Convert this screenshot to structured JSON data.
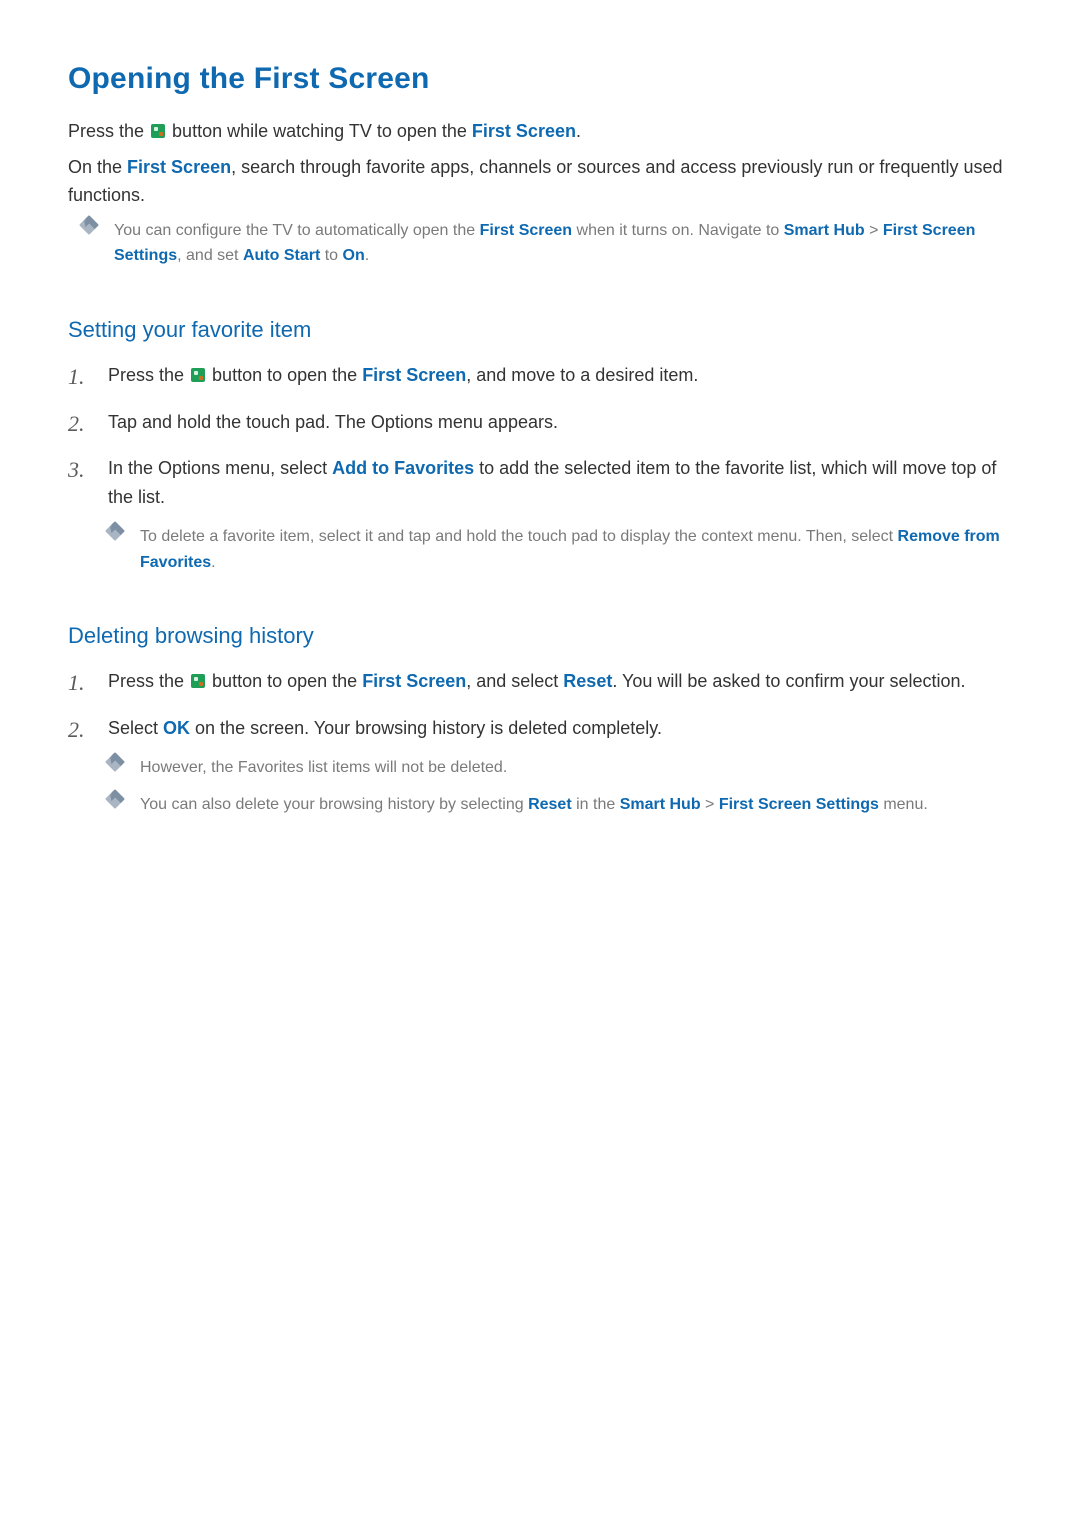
{
  "title": "Opening the First Screen",
  "intro1": {
    "pre": "Press the ",
    "post": " button while watching TV to open the ",
    "link": "First Screen",
    "end": "."
  },
  "intro2": {
    "pre": "On the ",
    "link": "First Screen",
    "post": ", search through favorite apps, channels or sources and access previously run or frequently used functions."
  },
  "note1": {
    "pre": "You can configure the TV to automatically open the ",
    "l1": "First Screen",
    "mid1": " when it turns on. Navigate to ",
    "l2": "Smart Hub",
    "gt": " > ",
    "l3": "First Screen Settings",
    "mid2": ", and set ",
    "l4": "Auto Start",
    "mid3": " to ",
    "l5": "On",
    "end": "."
  },
  "section_fav": "Setting your favorite item",
  "fav_steps": {
    "s1": {
      "pre": "Press the ",
      "mid": " button to open the ",
      "link": "First Screen",
      "post": ", and move to a desired item."
    },
    "s2": "Tap and hold the touch pad. The Options menu appears.",
    "s3": {
      "pre": "In the Options menu, select ",
      "link": "Add to Favorites",
      "post": " to add the selected item to the favorite list, which will move top of the list."
    },
    "s3note": {
      "pre": "To delete a favorite item, select it and tap and hold the touch pad to display the context menu. Then, select ",
      "link": "Remove from Favorites",
      "end": "."
    }
  },
  "section_del": "Deleting browsing history",
  "del_steps": {
    "s1": {
      "pre": "Press the ",
      "mid": " button to open the ",
      "link1": "First Screen",
      "mid2": ", and select ",
      "link2": "Reset",
      "post": ". You will be asked to confirm your selection."
    },
    "s2": {
      "pre": "Select ",
      "link": "OK",
      "post": " on the screen. Your browsing history is deleted completely."
    },
    "s2note1": "However, the Favorites list items will not be deleted.",
    "s2note2": {
      "pre": "You can also delete your browsing history by selecting ",
      "l1": "Reset",
      "mid": " in the ",
      "l2": "Smart Hub",
      "gt": " > ",
      "l3": "First Screen Settings",
      "post": " menu."
    }
  }
}
